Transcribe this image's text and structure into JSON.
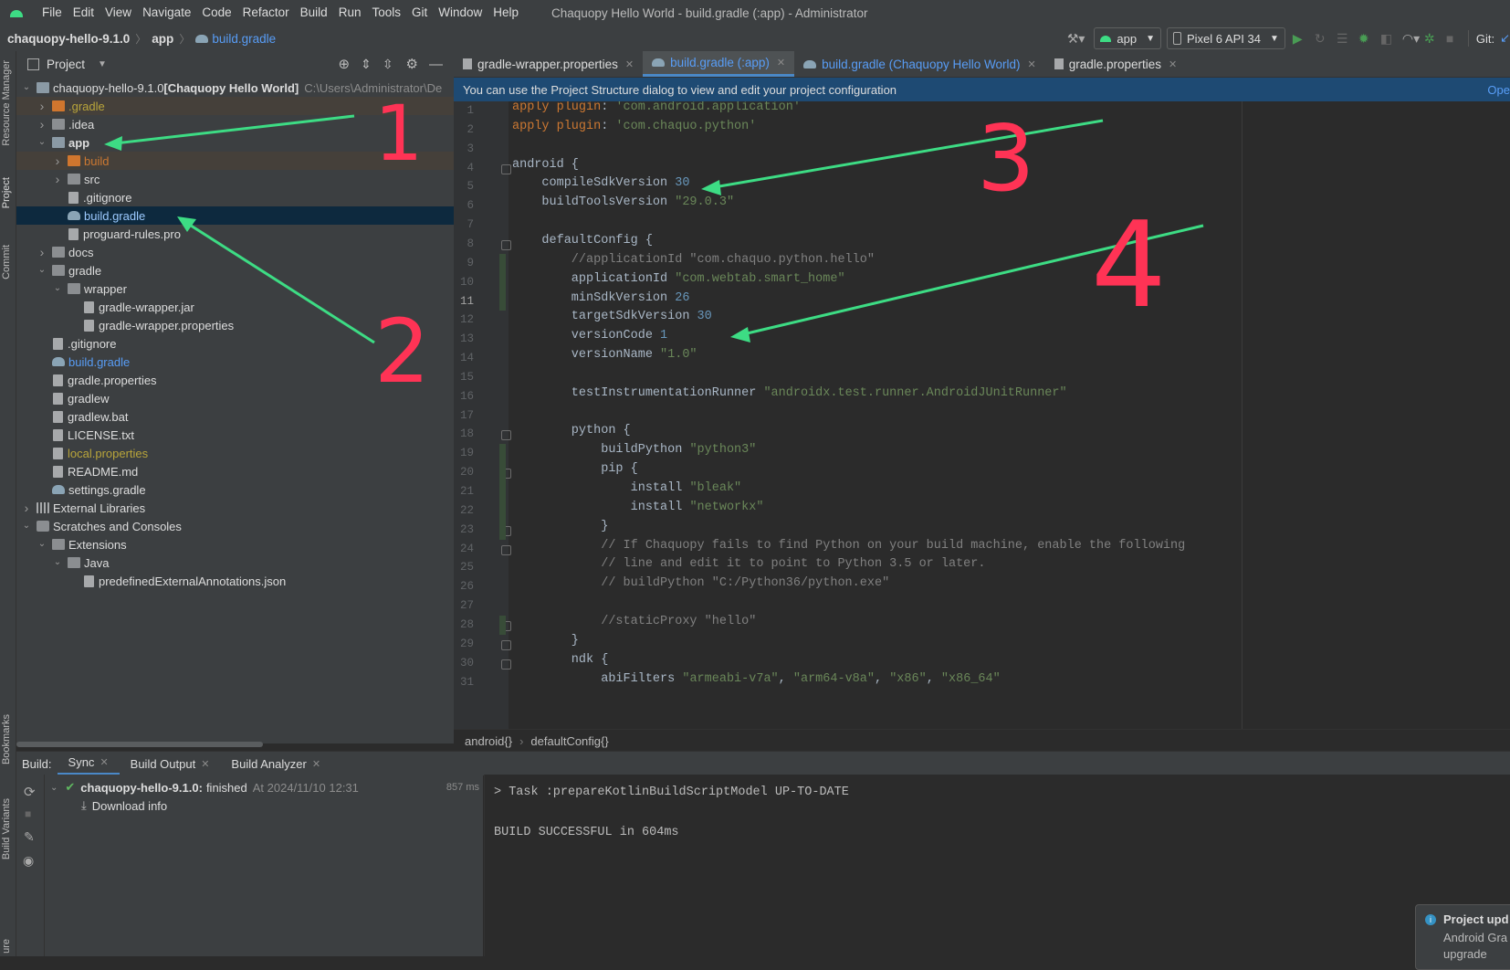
{
  "menu": {
    "items": [
      "File",
      "Edit",
      "View",
      "Navigate",
      "Code",
      "Refactor",
      "Build",
      "Run",
      "Tools",
      "Git",
      "Window",
      "Help"
    ],
    "window_title": "Chaquopy Hello World - build.gradle (:app) - Administrator"
  },
  "navbar": {
    "project": "chaquopy-hello-9.1.0",
    "module": "app",
    "file": "build.gradle",
    "run_config": "app",
    "device": "Pixel 6 API 34",
    "git_label": "Git:"
  },
  "left_stripe": {
    "resource_manager": "Resource Manager",
    "project": "Project",
    "commit": "Commit",
    "bookmarks": "Bookmarks",
    "build_variants": "Build Variants",
    "structure": "ure"
  },
  "project_panel": {
    "title": "Project",
    "tree": [
      {
        "label": "chaquopy-hello-9.1.0",
        "extra": "[Chaquopy Hello World]",
        "path": "C:\\Users\\Administrator\\De",
        "indent": 0,
        "expanded": true,
        "type": "module"
      },
      {
        "label": ".gradle",
        "indent": 1,
        "expanded": false,
        "type": "folder-orange",
        "color": "yellow",
        "hl": true
      },
      {
        "label": ".idea",
        "indent": 1,
        "expanded": false,
        "type": "folder"
      },
      {
        "label": "app",
        "indent": 1,
        "expanded": true,
        "type": "module",
        "bold": true
      },
      {
        "label": "build",
        "indent": 2,
        "expanded": false,
        "type": "folder-orange",
        "color": "orange",
        "hl": true
      },
      {
        "label": "src",
        "indent": 2,
        "expanded": false,
        "type": "folder"
      },
      {
        "label": ".gitignore",
        "indent": 2,
        "type": "file"
      },
      {
        "label": "build.gradle",
        "indent": 2,
        "type": "gradle",
        "selected": true
      },
      {
        "label": "proguard-rules.pro",
        "indent": 2,
        "type": "file"
      },
      {
        "label": "docs",
        "indent": 1,
        "expanded": false,
        "type": "folder"
      },
      {
        "label": "gradle",
        "indent": 1,
        "expanded": true,
        "type": "folder"
      },
      {
        "label": "wrapper",
        "indent": 2,
        "expanded": true,
        "type": "folder"
      },
      {
        "label": "gradle-wrapper.jar",
        "indent": 3,
        "type": "file"
      },
      {
        "label": "gradle-wrapper.properties",
        "indent": 3,
        "type": "file"
      },
      {
        "label": ".gitignore",
        "indent": 1,
        "type": "file"
      },
      {
        "label": "build.gradle",
        "indent": 1,
        "type": "gradle",
        "color": "blue"
      },
      {
        "label": "gradle.properties",
        "indent": 1,
        "type": "file"
      },
      {
        "label": "gradlew",
        "indent": 1,
        "type": "file"
      },
      {
        "label": "gradlew.bat",
        "indent": 1,
        "type": "file"
      },
      {
        "label": "LICENSE.txt",
        "indent": 1,
        "type": "file"
      },
      {
        "label": "local.properties",
        "indent": 1,
        "type": "file",
        "color": "yellow"
      },
      {
        "label": "README.md",
        "indent": 1,
        "type": "file"
      },
      {
        "label": "settings.gradle",
        "indent": 1,
        "type": "gradle"
      },
      {
        "label": "External Libraries",
        "indent": 0,
        "expanded": false,
        "type": "lib"
      },
      {
        "label": "Scratches and Consoles",
        "indent": 0,
        "expanded": true,
        "type": "scratch"
      },
      {
        "label": "Extensions",
        "indent": 1,
        "expanded": true,
        "type": "folder"
      },
      {
        "label": "Java",
        "indent": 2,
        "expanded": true,
        "type": "folder"
      },
      {
        "label": "predefinedExternalAnnotations.json",
        "indent": 3,
        "type": "file"
      }
    ]
  },
  "editor": {
    "tabs": [
      {
        "label": "gradle-wrapper.properties",
        "active": false
      },
      {
        "label": "build.gradle (:app)",
        "active": true
      },
      {
        "label": "build.gradle (Chaquopy Hello World)",
        "active": false,
        "blue": true
      },
      {
        "label": "gradle.properties",
        "active": false
      }
    ],
    "banner": "You can use the Project Structure dialog to view and edit your project configuration",
    "banner_action": "Ope",
    "current_line": 11,
    "lines": [
      [
        [
          "kw",
          "apply plugin"
        ],
        [
          "t",
          ": "
        ],
        [
          "str",
          "'com.android.application'"
        ]
      ],
      [
        [
          "kw",
          "apply plugin"
        ],
        [
          "t",
          ": "
        ],
        [
          "str",
          "'com.chaquo.python'"
        ]
      ],
      [],
      [
        [
          "t",
          "android {"
        ]
      ],
      [
        [
          "t",
          "    compileSdkVersion "
        ],
        [
          "num",
          "30"
        ]
      ],
      [
        [
          "t",
          "    buildToolsVersion "
        ],
        [
          "str",
          "\"29.0.3\""
        ]
      ],
      [],
      [
        [
          "t",
          "    defaultConfig {"
        ]
      ],
      [
        [
          "cm",
          "        //applicationId \"com.chaquo.python.hello\""
        ]
      ],
      [
        [
          "t",
          "        applicationId "
        ],
        [
          "str",
          "\"com.webtab.smart_home\""
        ]
      ],
      [
        [
          "t",
          "        minSdkVersion "
        ],
        [
          "num",
          "26"
        ]
      ],
      [
        [
          "t",
          "        targetSdkVersion "
        ],
        [
          "num",
          "30"
        ]
      ],
      [
        [
          "t",
          "        versionCode "
        ],
        [
          "num",
          "1"
        ]
      ],
      [
        [
          "t",
          "        versionName "
        ],
        [
          "str",
          "\"1.0\""
        ]
      ],
      [],
      [
        [
          "t",
          "        testInstrumentationRunner "
        ],
        [
          "str",
          "\"androidx.test.runner.AndroidJUnitRunner\""
        ]
      ],
      [],
      [
        [
          "t",
          "        python {"
        ]
      ],
      [
        [
          "t",
          "            buildPython "
        ],
        [
          "str",
          "\"python3\""
        ]
      ],
      [
        [
          "t",
          "            pip {"
        ]
      ],
      [
        [
          "t",
          "                install "
        ],
        [
          "str",
          "\"bleak\""
        ]
      ],
      [
        [
          "t",
          "                install "
        ],
        [
          "str",
          "\"networkx\""
        ]
      ],
      [
        [
          "t",
          "            }"
        ]
      ],
      [
        [
          "cm",
          "            // If Chaquopy fails to find Python on your build machine, enable the following"
        ]
      ],
      [
        [
          "cm",
          "            // line and edit it to point to Python 3.5 or later."
        ]
      ],
      [
        [
          "cm",
          "            // buildPython \"C:/Python36/python.exe\""
        ]
      ],
      [],
      [
        [
          "cm",
          "            //staticProxy \"hello\""
        ]
      ],
      [
        [
          "t",
          "        }"
        ]
      ],
      [
        [
          "t",
          "        ndk {"
        ]
      ],
      [
        [
          "t",
          "            abiFilters "
        ],
        [
          "str",
          "\"armeabi-v7a\""
        ],
        [
          "t",
          ", "
        ],
        [
          "str",
          "\"arm64-v8a\""
        ],
        [
          "t",
          ", "
        ],
        [
          "str",
          "\"x86\""
        ],
        [
          "t",
          ", "
        ],
        [
          "str",
          "\"x86_64\""
        ]
      ]
    ],
    "breadcrumb": [
      "android{}",
      "defaultConfig{}"
    ]
  },
  "build_panel": {
    "label": "Build:",
    "tabs": [
      "Sync",
      "Build Output",
      "Build Analyzer"
    ],
    "tree": {
      "title": "chaquopy-hello-9.1.0:",
      "status": "finished",
      "time": "At 2024/11/10 12:31",
      "duration": "857 ms",
      "child": "Download info"
    },
    "console": [
      "> Task :prepareKotlinBuildScriptModel UP-TO-DATE",
      "",
      "BUILD SUCCESSFUL in 604ms"
    ]
  },
  "notification": {
    "title": "Project upd",
    "line1": "Android Gra",
    "line2": "upgrade"
  },
  "annotations": {
    "labels": [
      "1",
      "2",
      "3",
      "4"
    ],
    "arrow_color": "#3ddc84",
    "label_color": "#ff3355"
  }
}
